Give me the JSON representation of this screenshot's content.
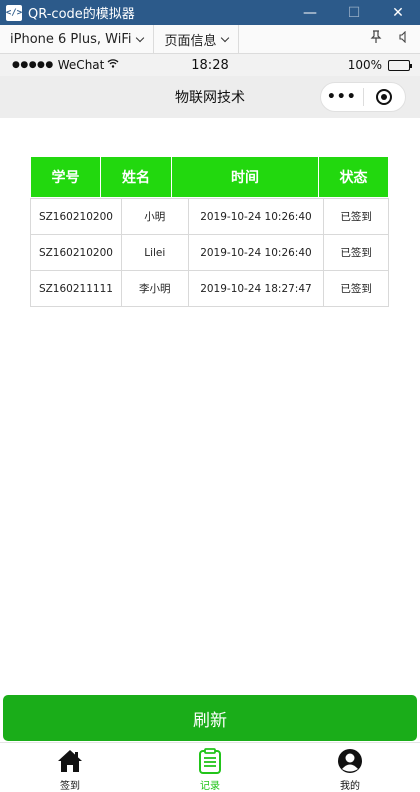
{
  "window": {
    "title": "QR-code的模拟器",
    "minimize": "—",
    "maximize": "☐",
    "close": "✕"
  },
  "toolbar": {
    "device": "iPhone 6 Plus, WiFi",
    "page_info": "页面信息"
  },
  "statusbar": {
    "signal": "●●●●●",
    "carrier": "WeChat",
    "time": "18:28",
    "battery": "100%"
  },
  "navbar": {
    "title": "物联网技术"
  },
  "table": {
    "headers": [
      "学号",
      "姓名",
      "时间",
      "状态"
    ],
    "rows": [
      [
        "SZ160210200",
        "小明",
        "2019-10-24 10:26:40",
        "已签到"
      ],
      [
        "SZ160210200",
        "Lilei",
        "2019-10-24 10:26:40",
        "已签到"
      ],
      [
        "SZ160211111",
        "李小明",
        "2019-10-24 18:27:47",
        "已签到"
      ]
    ]
  },
  "refresh_label": "刷新",
  "tabs": [
    {
      "label": "签到",
      "icon": "home-icon"
    },
    {
      "label": "记录",
      "icon": "clipboard-icon"
    },
    {
      "label": "我的",
      "icon": "user-icon"
    }
  ],
  "colors": {
    "header_green": "#22d80e",
    "button_green": "#1aad19",
    "active_tab": "#22c41a",
    "titlebar": "#2c5a8a"
  }
}
